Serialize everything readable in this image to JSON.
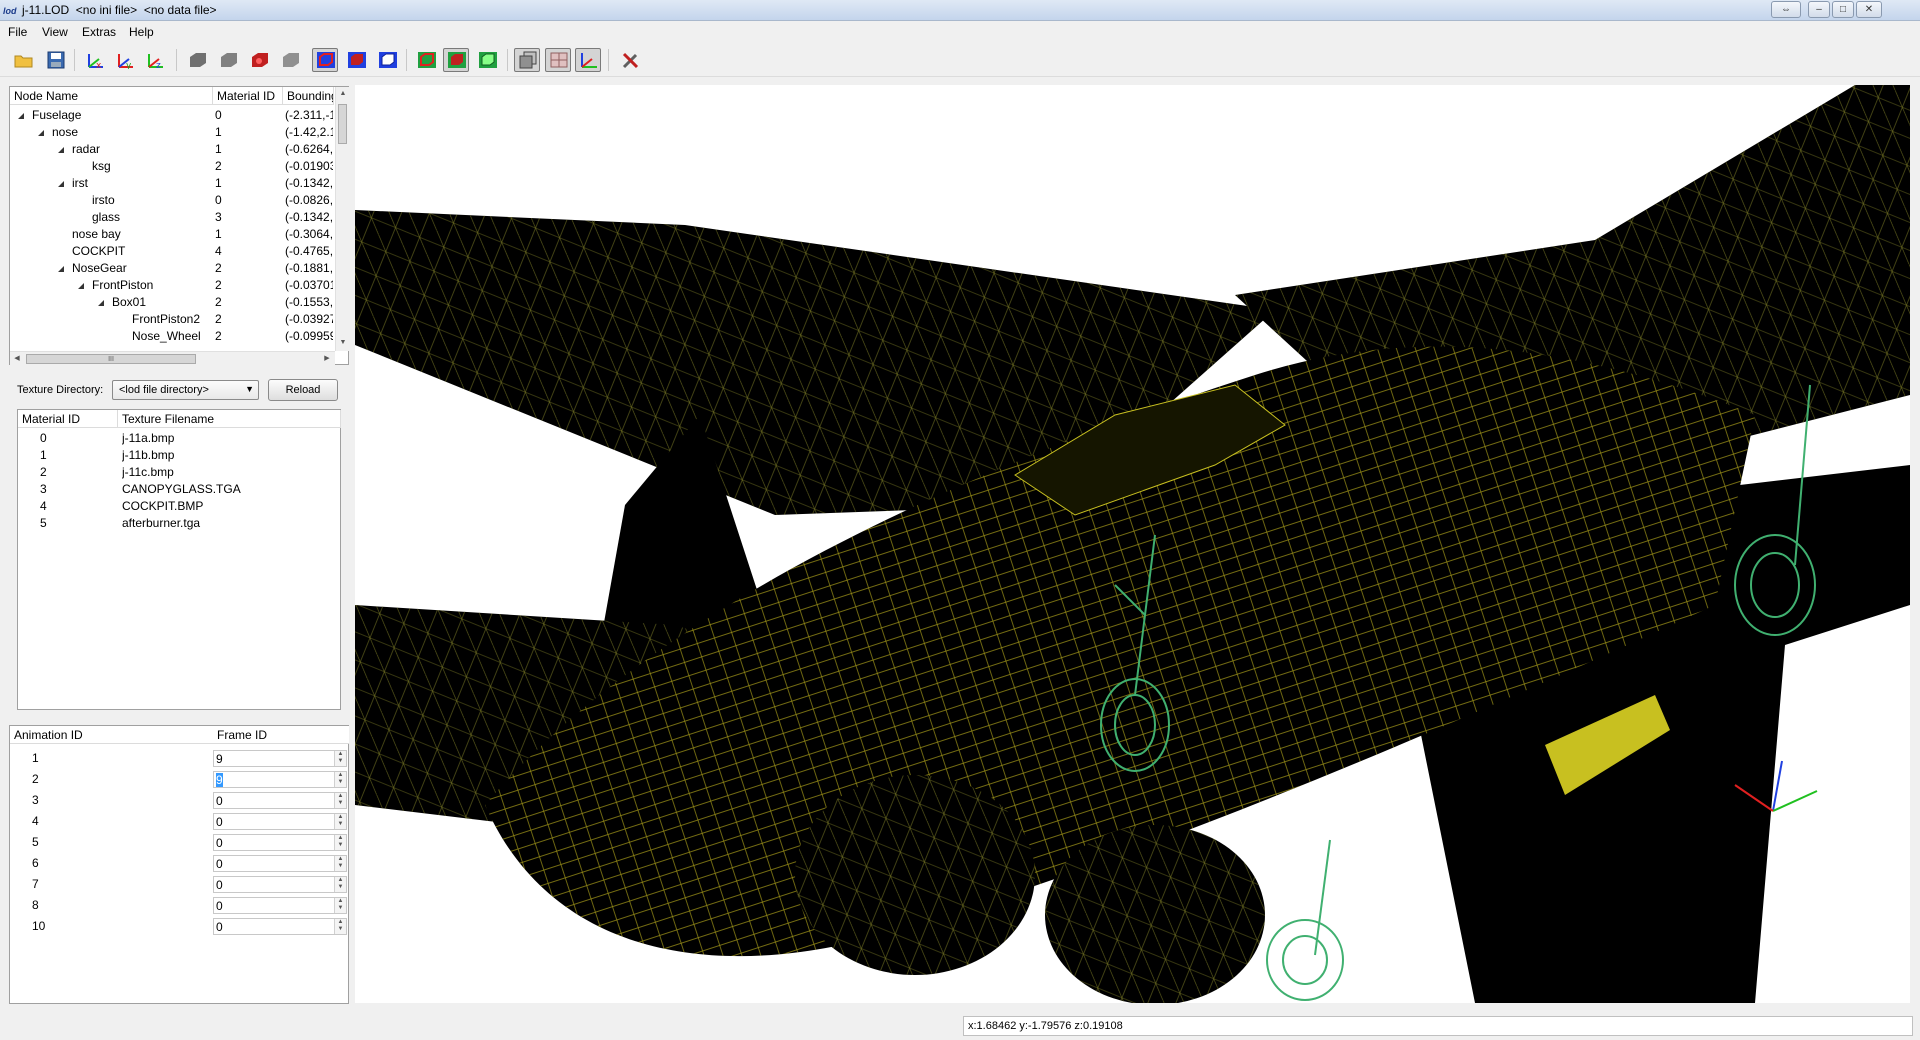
{
  "window": {
    "title": "j-11.LOD  <no ini file>  <no data file>",
    "app_icon": "lod"
  },
  "menu": [
    "File",
    "View",
    "Extras",
    "Help"
  ],
  "node_tree": {
    "headers": [
      "Node Name",
      "Material ID",
      "Bounding"
    ],
    "rows": [
      {
        "name": "Fuselage",
        "material": "0",
        "bounds": "(-2.311,-1"
      },
      {
        "name": "nose",
        "material": "1",
        "bounds": "(-1.42,2.1("
      },
      {
        "name": "radar",
        "material": "1",
        "bounds": "(-0.6264,7"
      },
      {
        "name": "ksg",
        "material": "2",
        "bounds": "(-0.01903,"
      },
      {
        "name": "irst",
        "material": "1",
        "bounds": "(-0.1342,6"
      },
      {
        "name": "irsto",
        "material": "0",
        "bounds": "(-0.0826,6"
      },
      {
        "name": "glass",
        "material": "3",
        "bounds": "(-0.1342,6"
      },
      {
        "name": "nose bay",
        "material": "1",
        "bounds": "(-0.3064,2"
      },
      {
        "name": "COCKPIT",
        "material": "4",
        "bounds": "(-0.4765,3"
      },
      {
        "name": "NoseGear",
        "material": "2",
        "bounds": "(-0.1881,2"
      },
      {
        "name": "FrontPiston",
        "material": "2",
        "bounds": "(-0.03701,"
      },
      {
        "name": "Box01",
        "material": "2",
        "bounds": "(-0.1553,3"
      },
      {
        "name": "FrontPiston2",
        "material": "2",
        "bounds": "(-0.03927,"
      },
      {
        "name": "Nose_Wheel",
        "material": "2",
        "bounds": "(-0.09959,"
      }
    ],
    "hscroll_grip": "III"
  },
  "texture": {
    "dir_label": "Texture Directory:",
    "dir_value": "<lod file directory>",
    "reload_label": "Reload",
    "headers": [
      "Material ID",
      "Texture Filename"
    ],
    "rows": [
      {
        "id": "0",
        "file": "j-11a.bmp"
      },
      {
        "id": "1",
        "file": "j-11b.bmp"
      },
      {
        "id": "2",
        "file": "j-11c.bmp"
      },
      {
        "id": "3",
        "file": "CANOPYGLASS.TGA"
      },
      {
        "id": "4",
        "file": "COCKPIT.BMP"
      },
      {
        "id": "5",
        "file": "afterburner.tga"
      }
    ]
  },
  "animation": {
    "headers": [
      "Animation ID",
      "Frame ID"
    ],
    "rows": [
      {
        "id": "1",
        "frame": "9"
      },
      {
        "id": "2",
        "frame": "9"
      },
      {
        "id": "3",
        "frame": "0"
      },
      {
        "id": "4",
        "frame": "0"
      },
      {
        "id": "5",
        "frame": "0"
      },
      {
        "id": "6",
        "frame": "0"
      },
      {
        "id": "7",
        "frame": "0"
      },
      {
        "id": "8",
        "frame": "0"
      },
      {
        "id": "10",
        "frame": "0"
      }
    ]
  },
  "status": {
    "coords": "x:1.68462 y:-1.79576 z:0.19108"
  },
  "colors": {
    "wire_yellow": "#c8c020",
    "wire_green": "#40b070",
    "axis_x": "#e02020",
    "axis_y": "#20c020",
    "axis_z": "#2040e0"
  }
}
